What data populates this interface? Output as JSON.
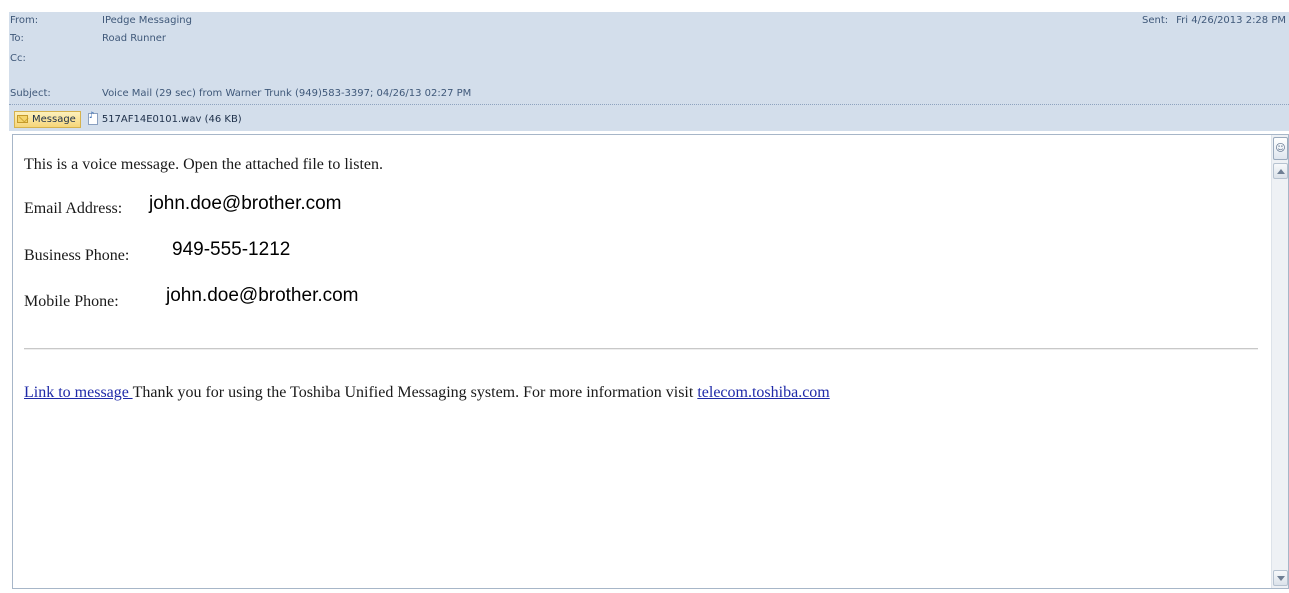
{
  "header": {
    "from_label": "From:",
    "from_value": "IPedge Messaging",
    "to_label": "To:",
    "to_value": "Road Runner",
    "cc_label": "Cc:",
    "cc_value": "",
    "subject_label": "Subject:",
    "subject_value": "Voice Mail (29 sec) from Warner Trunk (949)583-3397; 04/26/13 02:27 PM",
    "sent_label": "Sent:",
    "sent_value": "Fri 4/26/2013 2:28 PM"
  },
  "tabs": {
    "message_label": "Message",
    "attachment_label": "517AF14E0101.wav (46 KB)",
    "message_icon": "envelope-icon",
    "attachment_icon": "audio-file-icon"
  },
  "body": {
    "intro": "This is a voice message. Open the attached file to listen.",
    "email_label": "Email Address:",
    "email_value": "john.doe@brother.com",
    "business_label": "Business Phone:",
    "business_value": "949-555-1212",
    "mobile_label": "Mobile Phone:",
    "mobile_value": "john.doe@brother.com",
    "link_text": "Link to message ",
    "footer_text": "Thank you for using the Toshiba Unified Messaging system. For more information visit ",
    "site_link": "telecom.toshiba.com"
  },
  "colors": {
    "header_bg": "#d3deeb",
    "header_text": "#3f5879",
    "link": "#1f2aa8"
  }
}
